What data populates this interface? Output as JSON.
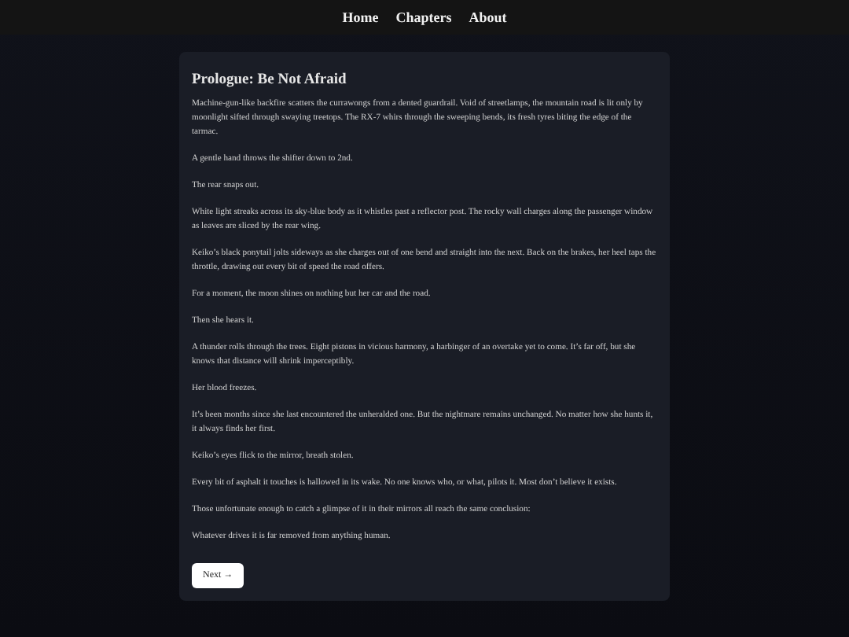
{
  "nav": {
    "links": [
      "Home",
      "Chapters",
      "About"
    ]
  },
  "chapter": {
    "title": "Prologue: Be Not Afraid",
    "paragraphs": [
      "Machine-gun-like backfire scatters the currawongs from a dented guardrail. Void of streetlamps, the mountain road is lit only by moonlight sifted through swaying treetops. The RX-7 whirs through the sweeping bends, its fresh tyres biting the edge of the tarmac.",
      "A gentle hand throws the shifter down to 2nd.",
      "The rear snaps out.",
      "White light streaks across its sky-blue body as it whistles past a reflector post. The rocky wall charges along the passenger window as leaves are sliced by the rear wing.",
      "Keiko’s black ponytail jolts sideways as she charges out of one bend and straight into the next. Back on the brakes, her heel taps the throttle, drawing out every bit of speed the road offers.",
      "For a moment, the moon shines on nothing but her car and the road.",
      "Then she hears it.",
      "A thunder rolls through the trees. Eight pistons in vicious harmony, a harbinger of an overtake yet to come. It’s far off, but she knows that distance will shrink imperceptibly.",
      "Her blood freezes.",
      "It’s been months since she last encountered the unheralded one. But the nightmare remains unchanged. No matter how she hunts it, it always finds her first.",
      "Keiko’s eyes flick to the mirror, breath stolen.",
      "Every bit of asphalt it touches is hallowed in its wake. No one knows who, or what, pilots it. Most don’t believe it exists.",
      "Those unfortunate enough to catch a glimpse of it in their mirrors all reach the same conclusion:",
      "Whatever drives it is far removed from anything human."
    ],
    "next_button": "Next →"
  }
}
